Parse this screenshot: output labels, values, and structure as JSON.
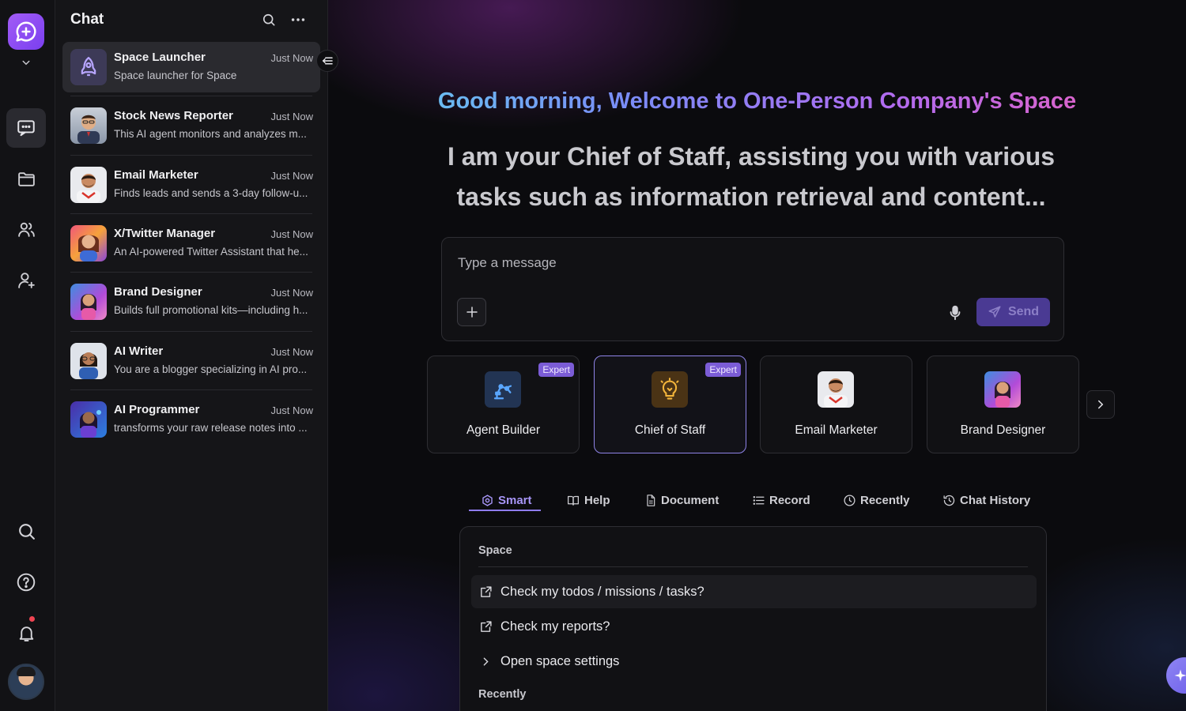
{
  "panel": {
    "title": "Chat",
    "chats": [
      {
        "name": "Space Launcher",
        "time": "Just Now",
        "preview": "Space launcher for Space",
        "avatar": "rocket-icon"
      },
      {
        "name": "Stock News Reporter",
        "time": "Just Now",
        "preview": "This AI agent monitors and analyzes m...",
        "avatar": "reporter-avatar"
      },
      {
        "name": "Email Marketer",
        "time": "Just Now",
        "preview": "Finds leads and sends a 3-day follow-u...",
        "avatar": "email-marketer-avatar"
      },
      {
        "name": "X/Twitter Manager",
        "time": "Just Now",
        "preview": "An AI-powered Twitter Assistant that he...",
        "avatar": "twitter-manager-avatar"
      },
      {
        "name": "Brand Designer",
        "time": "Just Now",
        "preview": "Builds full promotional kits—including h...",
        "avatar": "brand-designer-avatar"
      },
      {
        "name": "AI Writer",
        "time": "Just Now",
        "preview": "You are a blogger specializing in AI pro...",
        "avatar": "ai-writer-avatar"
      },
      {
        "name": "AI Programmer",
        "time": "Just Now",
        "preview": "transforms your raw release notes into ...",
        "avatar": "ai-programmer-avatar"
      }
    ]
  },
  "main": {
    "greeting": "Good morning, Welcome to One-Person Company's Space",
    "intro": "I am your Chief of Staff, assisting you with various tasks such as information retrieval and content...",
    "composer": {
      "placeholder": "Type a message",
      "send_label": "Send"
    },
    "agents": [
      {
        "label": "Agent Builder",
        "badge": "Expert",
        "icon": "robot-arm-icon"
      },
      {
        "label": "Chief of Staff",
        "badge": "Expert",
        "icon": "lightbulb-icon"
      },
      {
        "label": "Email Marketer",
        "badge": "",
        "icon": "email-marketer-avatar"
      },
      {
        "label": "Brand Designer",
        "badge": "",
        "icon": "brand-designer-avatar"
      }
    ],
    "tabs": [
      {
        "label": "Smart",
        "icon": "smart-icon",
        "active": true
      },
      {
        "label": "Help",
        "icon": "book-icon"
      },
      {
        "label": "Document",
        "icon": "document-icon"
      },
      {
        "label": "Record",
        "icon": "list-icon"
      },
      {
        "label": "Recently",
        "icon": "clock-icon"
      },
      {
        "label": "Chat History",
        "icon": "history-icon"
      }
    ],
    "suggestions": {
      "section_space": "Space",
      "items": [
        {
          "label": "Check my todos / missions / tasks?",
          "icon": "external-link-icon"
        },
        {
          "label": "Check my reports?",
          "icon": "external-link-icon"
        },
        {
          "label": "Open space settings",
          "icon": "chevron-right-icon"
        }
      ],
      "section_recent": "Recently"
    }
  },
  "colors": {
    "accent": "#8f7cf0",
    "logo": "#9a56f5",
    "send_button": "#4a3a93",
    "notification": "#f04452"
  }
}
